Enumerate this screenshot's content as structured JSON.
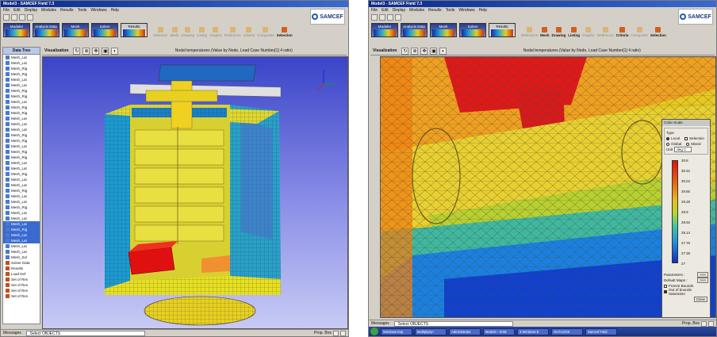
{
  "left": {
    "title": "Model3 - SAMCEF Field 7.3",
    "menu": [
      "File",
      "Edit",
      "Display",
      "Modules",
      "Results",
      "Tools",
      "Windows",
      "Help"
    ],
    "brand": "SAMCEF",
    "modules": [
      "Modeler",
      "Analysis Data",
      "Mesh",
      "Solver",
      "Results"
    ],
    "actions": [
      "Selection",
      "Mesh",
      "Drawing",
      "Listing",
      "Graphic",
      "Reference",
      "Criteria",
      "Composite",
      "Selection"
    ],
    "tree_title": "Data Tree",
    "tree_items": [
      "Mesh_Lat",
      "Mesh_Lat",
      "Mesh_Rig",
      "Mesh_Rig",
      "Mesh_Lat",
      "Mesh_Lat",
      "Mesh_Rig",
      "Mesh_Rig",
      "Mesh_Lat",
      "Mesh_Rig",
      "Mesh_Rig",
      "Mesh_Lat",
      "Mesh_Lat",
      "Mesh_Lat",
      "Mesh_Rig",
      "Mesh_Rig",
      "Mesh_Lat",
      "Mesh_Rig",
      "Mesh_Rig",
      "Mesh_Lat",
      "Mesh_Lat",
      "Mesh_Rig",
      "Mesh_Lat",
      "Mesh_Lat",
      "Mesh_Rig",
      "Mesh_Lat",
      "Mesh_Lat",
      "Mesh_Rig",
      "Mesh_Lat",
      "Mesh_Lat",
      "Mesh_Lat",
      "Mesh_Rig",
      "Mesh_Lat",
      "Mesh_Lat",
      "Mesh_Lat",
      "Mesh_Lat",
      "Mesh_Sol"
    ],
    "tree_results": [
      "Solver Data",
      "Results",
      "Load Def",
      "Set of Res",
      "Set of Res",
      "Set of Res",
      "Set of Res"
    ],
    "view_label": "Visualization",
    "view_title": "Nodal temperatures (Value by Node, Load Case Number[1] 4 ratio)",
    "status_label": "Messages",
    "status_msg": "Select OBJECTS",
    "status_right": "Prop. Box"
  },
  "right": {
    "title": "Model3 - SAMCEF Field 7.3",
    "menu": [
      "File",
      "Edit",
      "Display",
      "Modules",
      "Results",
      "Tools",
      "Windows",
      "Help"
    ],
    "brand": "SAMCEF",
    "modules": [
      "Modeler",
      "Analysis Data",
      "Mesh",
      "Solver",
      "Results"
    ],
    "actions": [
      "Definitions",
      "Mesh",
      "Drawing",
      "Listing",
      "Graphic",
      "Reference",
      "Criteria",
      "Composite",
      "Selection"
    ],
    "view_label": "Visualization",
    "view_title": "Nodal temperatures (Value by Node, Load Case Number[1] 4 ratio)",
    "status_label": "Messages",
    "status_msg": "Select OBJECTS",
    "status_right": "Prop. Box",
    "taskbar": [
      "Windows Exp",
      "Multiplysyn",
      "Administrator",
      "Model3 - SAM",
      "3 Windows E",
      "OUTLOOK",
      "Samcef Field"
    ],
    "color_scale": {
      "title": "Color Scale",
      "type_label": "Type",
      "opt_local": "Local",
      "opt_selection": "Selection",
      "opt_global": "Global",
      "opt_mixed": "Mixed",
      "unit_label": "Unit",
      "unit_value": "deg C",
      "ticks": [
        "30.8",
        "30.42",
        "30.04",
        "29.66",
        "29.28",
        "28.9",
        "28.52",
        "28.14",
        "27.76",
        "27.38",
        "27"
      ],
      "parameters_label": "Parameters :",
      "default_maps_label": "Default Maps :",
      "more": ">>>",
      "freeze_label": "Freeze Bounds",
      "saturation_label": "Out of bounds Saturation",
      "close_label": "Close"
    }
  }
}
